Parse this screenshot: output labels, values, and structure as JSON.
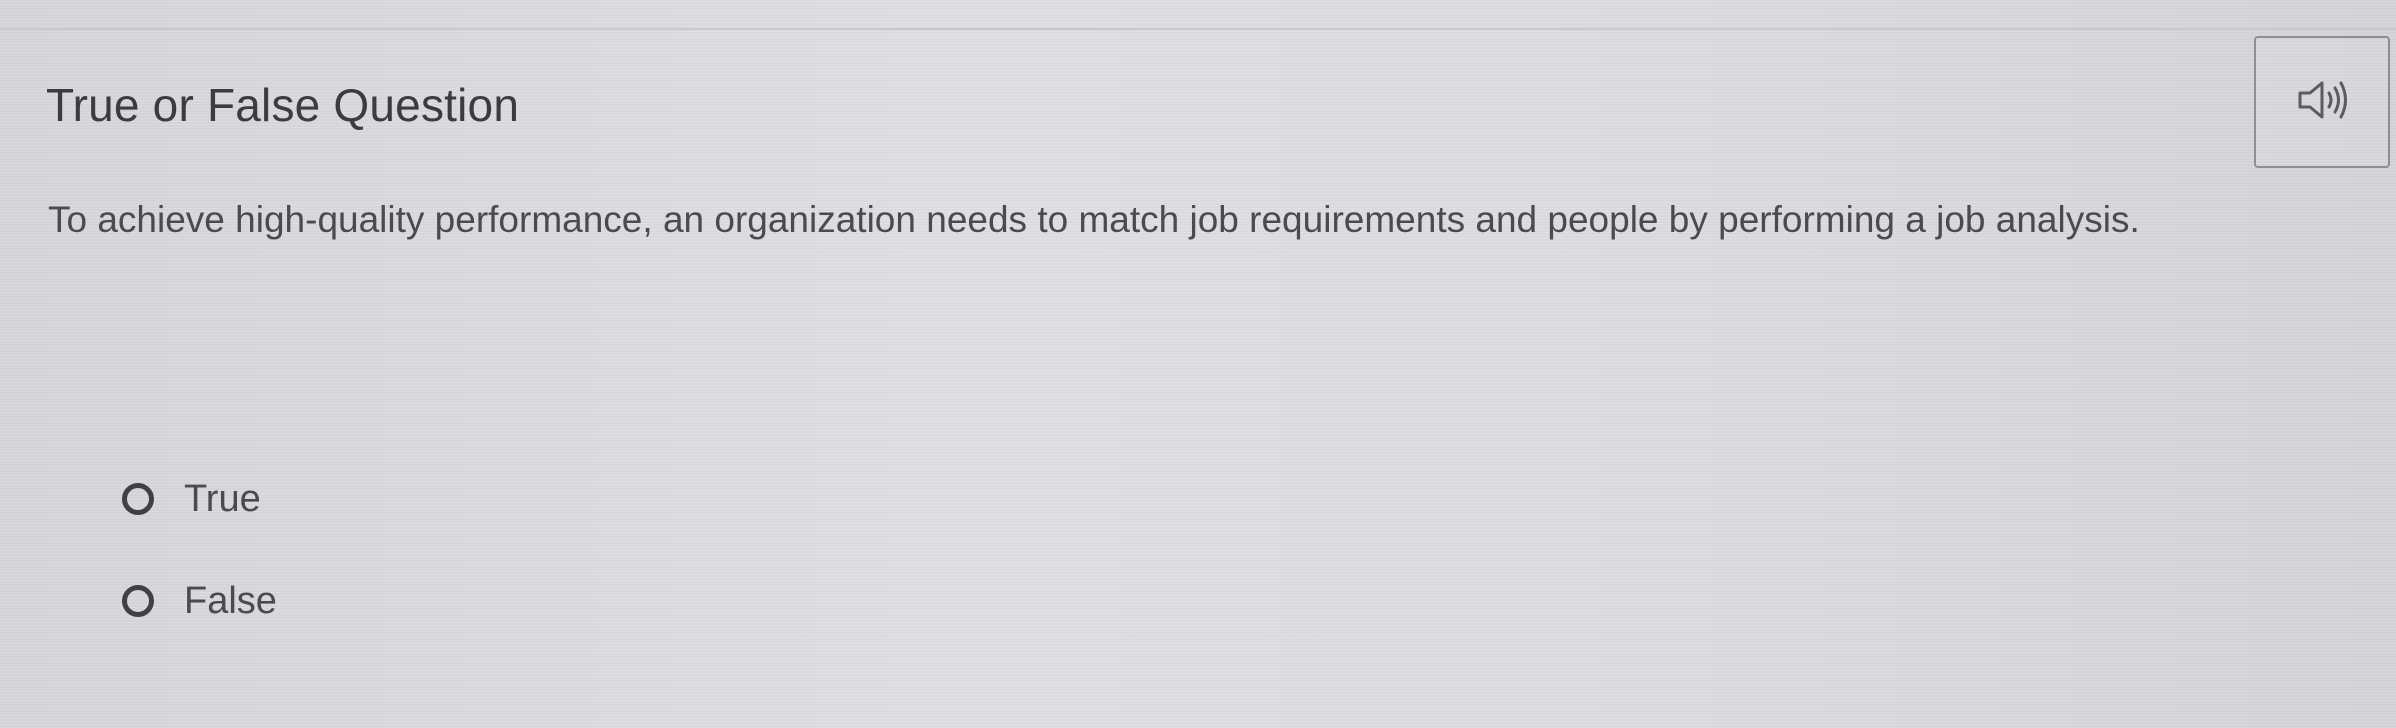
{
  "question": {
    "title": "True or False Question",
    "body": "To achieve high-quality performance, an organization needs to match job requirements and people by performing a job analysis."
  },
  "audio_button": {
    "icon": "speaker-icon"
  },
  "options": [
    {
      "label": "True",
      "selected": false
    },
    {
      "label": "False",
      "selected": false
    }
  ],
  "colors": {
    "text": "#3f3f44",
    "border": "#8e8e94"
  }
}
